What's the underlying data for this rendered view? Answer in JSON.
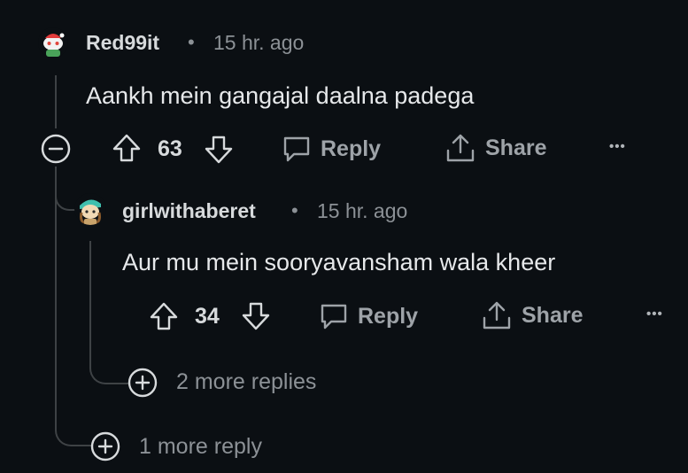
{
  "comment": {
    "username": "Red99it",
    "separator": "•",
    "time": "15 hr. ago",
    "text": "Aankh mein gangajal daalna padega",
    "votes": "63",
    "reply_label": "Reply",
    "share_label": "Share",
    "more_label": "•••",
    "collapse_icon": "minus-circle-icon"
  },
  "reply": {
    "username": "girlwithaberet",
    "separator": "•",
    "time": "15 hr. ago",
    "text": "Aur mu mein sooryavansham wala kheer",
    "votes": "34",
    "reply_label": "Reply",
    "share_label": "Share",
    "more_label": "•••",
    "more_replies": "2 more replies"
  },
  "thread": {
    "more_reply": "1 more reply"
  },
  "colors": {
    "background": "#0b0f13",
    "text": "#e6e8ea",
    "muted": "#8c9196",
    "line": "#3e4245"
  }
}
